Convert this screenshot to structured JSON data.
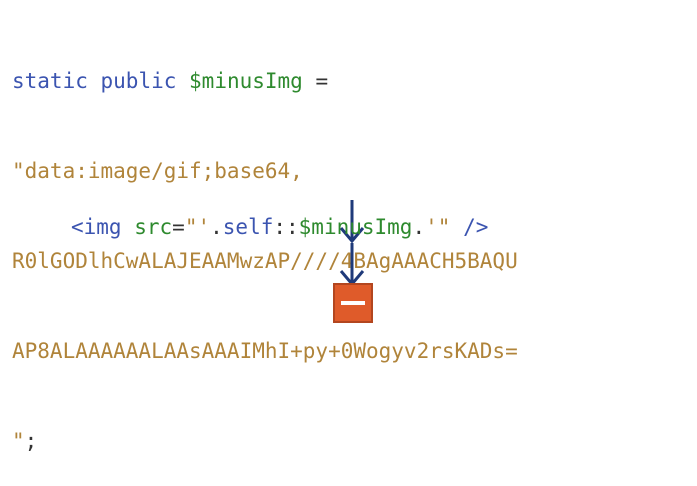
{
  "code": {
    "line1": {
      "kw1": "static",
      "kw2": "public",
      "var": "$minusImg",
      "op": "="
    },
    "line2": "\"data:image/gif;base64,",
    "line3": "R0lGODlhCwALAJEAAMwzAP////4BAgAAACH5BAQU",
    "line4": "AP8ALAAAAAALAAsAAAIMhI+py+0Wogyv2rsKADs=",
    "line5": {
      "str": "\"",
      "op": ";"
    }
  },
  "img_line": {
    "tag_open": "<img",
    "attr": "src",
    "eq": "=",
    "quote1": "\"'",
    "dot1": ".",
    "self": "self",
    "scope": "::",
    "var": "$minusImg",
    "dot2": ".",
    "quote2": "'\"",
    "tag_close": "/>"
  },
  "colors": {
    "keyword": "#3b54b0",
    "variable": "#2e8a2e",
    "string": "#b0843a",
    "arrow": "#1f3a7a",
    "icon_fill": "#df5b2a",
    "icon_border": "#b3461f"
  },
  "icons": {
    "arrow_top": "arrow-down-icon",
    "arrow_bottom": "arrow-down-icon",
    "result": "minus-icon"
  }
}
